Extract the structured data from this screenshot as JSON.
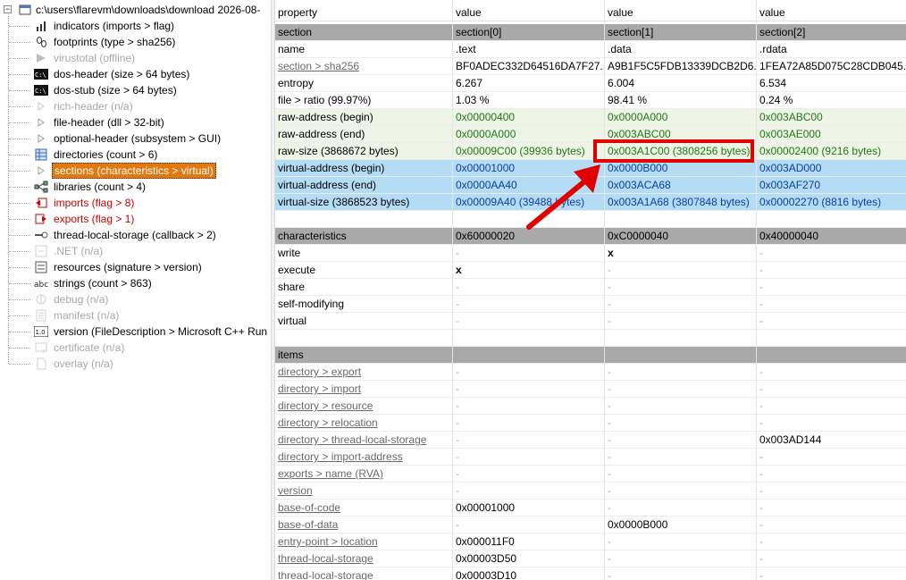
{
  "tree": {
    "root": "c:\\users\\flarevm\\downloads\\download 2026-08-",
    "items": [
      {
        "label": "indicators (imports > flag)",
        "icon": "bar-chart-icon",
        "state": "normal"
      },
      {
        "label": "footprints (type > sha256)",
        "icon": "footprints-icon",
        "state": "normal"
      },
      {
        "label": "virustotal (offline)",
        "icon": "virustotal-icon",
        "state": "disabled"
      },
      {
        "label": "dos-header (size > 64 bytes)",
        "icon": "console-icon",
        "state": "normal"
      },
      {
        "label": "dos-stub (size > 64 bytes)",
        "icon": "console-icon",
        "state": "normal"
      },
      {
        "label": "rich-header (n/a)",
        "icon": "arrow-icon",
        "state": "disabled"
      },
      {
        "label": "file-header (dll > 32-bit)",
        "icon": "arrow-icon",
        "state": "normal"
      },
      {
        "label": "optional-header (subsystem > GUI)",
        "icon": "arrow-icon",
        "state": "normal"
      },
      {
        "label": "directories (count > 6)",
        "icon": "grid-icon",
        "state": "normal"
      },
      {
        "label": "sections (characteristics > virtual)",
        "icon": "arrow-icon",
        "state": "selected"
      },
      {
        "label": "libraries (count > 4)",
        "icon": "network-icon",
        "state": "normal"
      },
      {
        "label": "imports (flag > 8)",
        "icon": "import-icon",
        "state": "red"
      },
      {
        "label": "exports (flag > 1)",
        "icon": "export-icon",
        "state": "red"
      },
      {
        "label": "thread-local-storage (callback > 2)",
        "icon": "thread-icon",
        "state": "normal"
      },
      {
        "label": ".NET (n/a)",
        "icon": "dotnet-icon",
        "state": "disabled"
      },
      {
        "label": "resources (signature > version)",
        "icon": "resource-icon",
        "state": "normal"
      },
      {
        "label": "strings (count > 863)",
        "icon": "strings-icon",
        "state": "normal"
      },
      {
        "label": "debug (n/a)",
        "icon": "debug-icon",
        "state": "disabled"
      },
      {
        "label": "manifest (n/a)",
        "icon": "manifest-icon",
        "state": "disabled"
      },
      {
        "label": "version (FileDescription > Microsoft C++ Run",
        "icon": "version-icon",
        "state": "normal"
      },
      {
        "label": "certificate (n/a)",
        "icon": "certificate-icon",
        "state": "disabled"
      },
      {
        "label": "overlay (n/a)",
        "icon": "overlay-icon",
        "state": "disabled"
      }
    ],
    "version_icon_text": "1.0",
    "strings_icon_text": "abc",
    "console_icon_text": "C:\\"
  },
  "grid": {
    "headers": [
      "property",
      "value",
      "value",
      "value"
    ],
    "rows": [
      {
        "style": "grey",
        "cells": [
          "section",
          "section[0]",
          "section[1]",
          "section[2]"
        ]
      },
      {
        "style": "plain",
        "cells": [
          "name",
          ".text",
          ".data",
          ".rdata"
        ]
      },
      {
        "style": "plain",
        "link": true,
        "cells": [
          "section > sha256",
          "BF0ADEC332D64516DA7F27...",
          "A9B1F5C5FDB13339DCB2D6...",
          "1FEA72A85D075C28CDB045..."
        ]
      },
      {
        "style": "plain",
        "cells": [
          "entropy",
          "6.267",
          "6.004",
          "6.534"
        ]
      },
      {
        "style": "plain",
        "cells": [
          "file > ratio (99.97%)",
          "1.03 %",
          "98.41 %",
          "0.24 %"
        ]
      },
      {
        "style": "green",
        "cells": [
          "raw-address (begin)",
          "0x00000400",
          "0x0000A000",
          "0x003ABC00"
        ]
      },
      {
        "style": "green",
        "cells": [
          "raw-address (end)",
          "0x0000A000",
          "0x003ABC00",
          "0x003AE000"
        ]
      },
      {
        "style": "green",
        "cells": [
          "raw-size (3868672 bytes)",
          "0x00009C00 (39936 bytes)",
          "0x003A1C00 (3808256 bytes)",
          "0x00002400 (9216 bytes)"
        ]
      },
      {
        "style": "blue",
        "cells": [
          "virtual-address (begin)",
          "0x00001000",
          "0x0000B000",
          "0x003AD000"
        ]
      },
      {
        "style": "blue",
        "cells": [
          "virtual-address (end)",
          "0x0000AA40",
          "0x003ACA68",
          "0x003AF270"
        ]
      },
      {
        "style": "blue",
        "cells": [
          "virtual-size (3868523 bytes)",
          "0x00009A40 (39488 bytes)",
          "0x003A1A68 (3807848 bytes)",
          "0x00002270 (8816 bytes)"
        ]
      },
      {
        "style": "empty",
        "cells": [
          "",
          "",
          "",
          ""
        ]
      },
      {
        "style": "grey",
        "cells": [
          "characteristics",
          "0x60000020",
          "0xC0000040",
          "0x40000040"
        ]
      },
      {
        "style": "plain",
        "cells": [
          "write",
          "-",
          "x",
          "-"
        ]
      },
      {
        "style": "plain",
        "cells": [
          "execute",
          "x",
          "-",
          "-"
        ]
      },
      {
        "style": "plain",
        "cells": [
          "share",
          "-",
          "-",
          "-"
        ]
      },
      {
        "style": "plain",
        "cells": [
          "self-modifying",
          "-",
          "-",
          "-"
        ]
      },
      {
        "style": "plain",
        "cells": [
          "virtual",
          "-",
          "-",
          "-"
        ]
      },
      {
        "style": "empty",
        "cells": [
          "",
          "",
          "",
          ""
        ]
      },
      {
        "style": "grey",
        "cells": [
          "items",
          "",
          "",
          ""
        ]
      },
      {
        "style": "plain",
        "link": true,
        "cells": [
          "directory > export",
          "-",
          "-",
          "-"
        ]
      },
      {
        "style": "plain",
        "link": true,
        "cells": [
          "directory > import",
          "-",
          "-",
          "-"
        ]
      },
      {
        "style": "plain",
        "link": true,
        "cells": [
          "directory > resource",
          "-",
          "-",
          "-"
        ]
      },
      {
        "style": "plain",
        "link": true,
        "cells": [
          "directory > relocation",
          "-",
          "-",
          "-"
        ]
      },
      {
        "style": "plain",
        "link": true,
        "cells": [
          "directory > thread-local-storage",
          "-",
          "-",
          "0x003AD144"
        ]
      },
      {
        "style": "plain",
        "link": true,
        "cells": [
          "directory > import-address",
          "-",
          "-",
          "-"
        ]
      },
      {
        "style": "plain",
        "link": true,
        "cells": [
          "exports > name (RVA)",
          "-",
          "-",
          "-"
        ]
      },
      {
        "style": "plain",
        "link": true,
        "cells": [
          "version",
          "-",
          "-",
          "-"
        ]
      },
      {
        "style": "plain",
        "link": true,
        "cells": [
          "base-of-code",
          "0x00001000",
          "-",
          "-"
        ]
      },
      {
        "style": "plain",
        "link": true,
        "cells": [
          "base-of-data",
          "-",
          "0x0000B000",
          "-"
        ]
      },
      {
        "style": "plain",
        "link": true,
        "cells": [
          "entry-point > location",
          "0x000011F0",
          "-",
          "-"
        ]
      },
      {
        "style": "plain",
        "link": true,
        "cells": [
          "thread-local-storage",
          "0x00003D50",
          "-",
          "-"
        ]
      },
      {
        "style": "plain",
        "link": true,
        "cells": [
          "thread-local-storage",
          "0x00003D10",
          "-",
          "-"
        ]
      }
    ]
  },
  "annotation": {
    "color": "#e00000",
    "shape": "red-arrow-icon"
  }
}
